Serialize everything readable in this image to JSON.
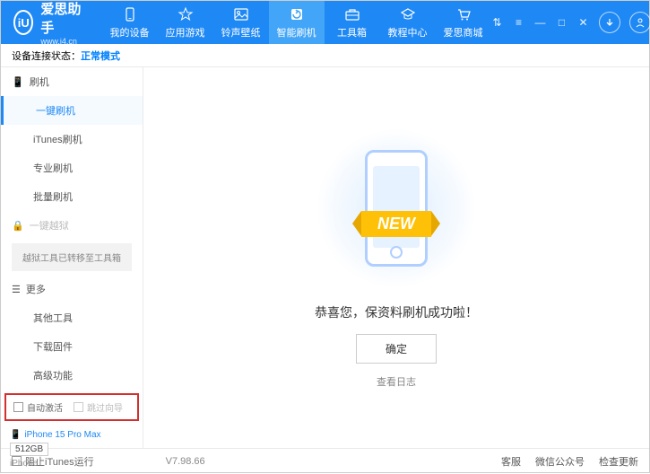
{
  "brand": {
    "name": "爱思助手",
    "url": "www.i4.cn",
    "logo_letter": "iU"
  },
  "nav": [
    {
      "label": "我的设备"
    },
    {
      "label": "应用游戏"
    },
    {
      "label": "铃声壁纸"
    },
    {
      "label": "智能刷机"
    },
    {
      "label": "工具箱"
    },
    {
      "label": "教程中心"
    },
    {
      "label": "爱思商城"
    }
  ],
  "status": {
    "label": "设备连接状态：",
    "mode": "正常模式"
  },
  "sidebar": {
    "section_flash": "刷机",
    "items_flash": [
      "一键刷机",
      "iTunes刷机",
      "专业刷机",
      "批量刷机"
    ],
    "section_jailbreak": "一键越狱",
    "jailbreak_notice": "越狱工具已转移至工具箱",
    "section_more": "更多",
    "items_more": [
      "其他工具",
      "下载固件",
      "高级功能"
    ],
    "auto_activate": "自动激活",
    "skip_guide": "跳过向导"
  },
  "device": {
    "name": "iPhone 15 Pro Max",
    "capacity": "512GB",
    "type": "iPhone"
  },
  "main": {
    "ribbon": "NEW",
    "message": "恭喜您，保资料刷机成功啦！",
    "ok": "确定",
    "view_log": "查看日志"
  },
  "footer": {
    "block_itunes": "阻止iTunes运行",
    "version": "V7.98.66",
    "links": [
      "客服",
      "微信公众号",
      "检查更新"
    ]
  }
}
